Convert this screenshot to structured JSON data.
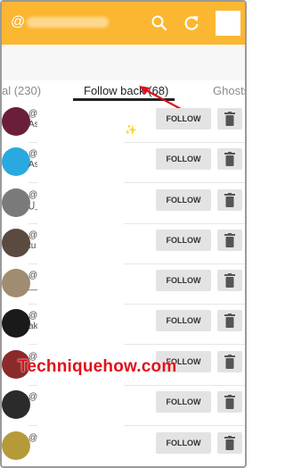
{
  "header": {
    "title_prefix": "@",
    "background": "#fbb731",
    "icons": [
      "search-icon",
      "refresh-icon"
    ]
  },
  "tabs": [
    {
      "label": "al (230)"
    },
    {
      "label": "Follow back (68)",
      "active": true
    },
    {
      "label": "Ghosts"
    }
  ],
  "rows": [
    {
      "name_line1": "@",
      "name_line2": "As",
      "avatar_color": "#6b1e3a",
      "follow_label": "FOLLOW"
    },
    {
      "name_line1": "@",
      "name_line2": "As",
      "avatar_color": "#2aa9e0",
      "follow_label": "FOLLOW"
    },
    {
      "name_line1": "@",
      "name_line2": "ل_",
      "avatar_color": "#7a7a7a",
      "follow_label": "FOLLOW"
    },
    {
      "name_line1": "@",
      "name_line2": "tu",
      "avatar_color": "#5b4a3f",
      "follow_label": "FOLLOW"
    },
    {
      "name_line1": "@",
      "name_line2": "__",
      "avatar_color": "#a08c70",
      "follow_label": "FOLLOW"
    },
    {
      "name_line1": "@",
      "name_line2": "ak",
      "avatar_color": "#1a1a1a",
      "follow_label": "FOLLOW"
    },
    {
      "name_line1": "@",
      "name_line2": "",
      "avatar_color": "#8b2a2a",
      "follow_label": "FOLLOW"
    },
    {
      "name_line1": "@",
      "name_line2": "",
      "avatar_color": "#2b2b2b",
      "follow_label": "FOLLOW"
    },
    {
      "name_line1": "@",
      "name_line2": "",
      "avatar_color": "#b59a3a",
      "follow_label": "FOLLOW"
    }
  ],
  "watermark": "Techniquehow.com",
  "accent_arrow_color": "#e0101b"
}
